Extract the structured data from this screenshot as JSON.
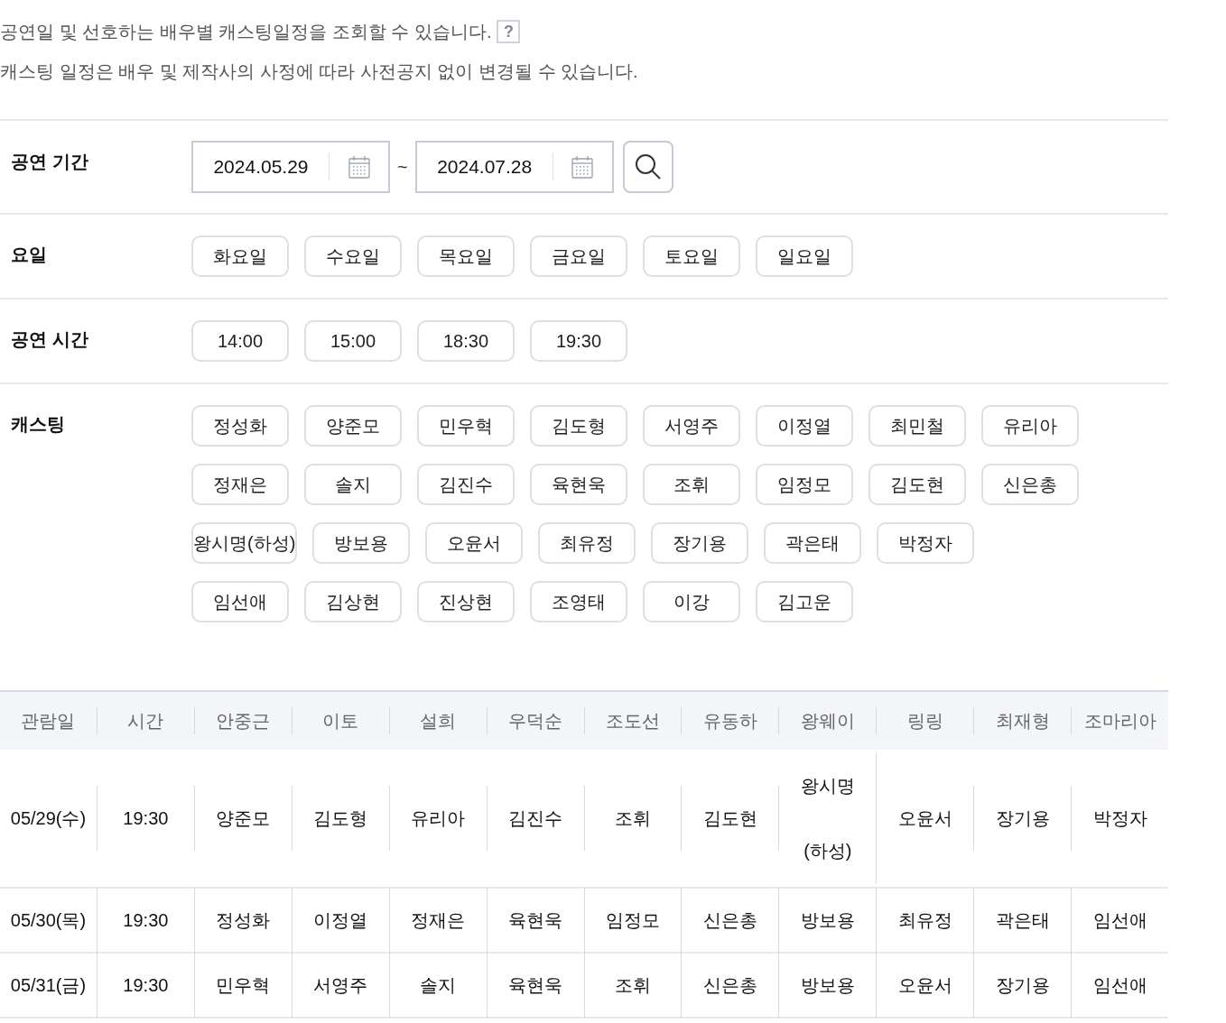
{
  "notes": [
    "공연일 및 선호하는 배우별 캐스팅일정을 조회할 수 있습니다.",
    "캐스팅 일정은 배우 및 제작사의 사정에 따라 사전공지 없이 변경될 수 있습니다."
  ],
  "help_button": "?",
  "period": {
    "label": "공연 기간",
    "start": "2024.05.29",
    "separator": "~",
    "end": "2024.07.28"
  },
  "days": {
    "label": "요일",
    "options": [
      {
        "label": "화요일",
        "selected": false
      },
      {
        "label": "수요일",
        "selected": false
      },
      {
        "label": "목요일",
        "selected": false
      },
      {
        "label": "금요일",
        "selected": false
      },
      {
        "label": "토요일",
        "selected": false
      },
      {
        "label": "일요일",
        "selected": false
      }
    ]
  },
  "times": {
    "label": "공연 시간",
    "options": [
      {
        "label": "14:00",
        "selected": false
      },
      {
        "label": "15:00",
        "selected": false
      },
      {
        "label": "18:30",
        "selected": false
      },
      {
        "label": "19:30",
        "selected": false
      }
    ]
  },
  "casting": {
    "label": "캐스팅",
    "rows": [
      [
        {
          "label": "정성화",
          "selected": false
        },
        {
          "label": "양준모",
          "selected": false
        },
        {
          "label": "민우혁",
          "selected": false
        },
        {
          "label": "김도형",
          "selected": false
        },
        {
          "label": "서영주",
          "selected": false
        },
        {
          "label": "이정열",
          "selected": false
        },
        {
          "label": "최민철",
          "selected": false
        },
        {
          "label": "유리아",
          "selected": false
        }
      ],
      [
        {
          "label": "정재은",
          "selected": false
        },
        {
          "label": "솔지",
          "selected": false
        },
        {
          "label": "김진수",
          "selected": false
        },
        {
          "label": "육현욱",
          "selected": false
        },
        {
          "label": "조휘",
          "selected": false
        },
        {
          "label": "임정모",
          "selected": false
        },
        {
          "label": "김도현",
          "selected": false
        },
        {
          "label": "신은총",
          "selected": false
        }
      ],
      [
        {
          "label": "왕시명(하성)",
          "selected": false
        },
        {
          "label": "방보용",
          "selected": false
        },
        {
          "label": "오윤서",
          "selected": false
        },
        {
          "label": "최유정",
          "selected": false
        },
        {
          "label": "장기용",
          "selected": false
        },
        {
          "label": "곽은태",
          "selected": false
        },
        {
          "label": "박정자",
          "selected": false
        }
      ],
      [
        {
          "label": "임선애",
          "selected": false
        },
        {
          "label": "김상현",
          "selected": false
        },
        {
          "label": "진상현",
          "selected": false
        },
        {
          "label": "조영태",
          "selected": false
        },
        {
          "label": "이강",
          "selected": false
        },
        {
          "label": "김고운",
          "selected": false
        }
      ]
    ]
  },
  "table": {
    "columns": [
      "관람일",
      "시간",
      "안중근",
      "이토",
      "설희",
      "우덕순",
      "조도선",
      "유동하",
      "왕웨이",
      "링링",
      "최재형",
      "조마리아"
    ],
    "rows": [
      [
        "05/29(수)",
        "19:30",
        "양준모",
        "김도형",
        "유리아",
        "김진수",
        "조휘",
        "김도현",
        "왕시명(하성)",
        "오윤서",
        "장기용",
        "박정자"
      ],
      [
        "05/30(목)",
        "19:30",
        "정성화",
        "이정열",
        "정재은",
        "육현욱",
        "임정모",
        "신은총",
        "방보용",
        "최유정",
        "곽은태",
        "임선애"
      ],
      [
        "05/31(금)",
        "19:30",
        "민우혁",
        "서영주",
        "솔지",
        "육현욱",
        "조휘",
        "신은총",
        "방보용",
        "오윤서",
        "장기용",
        "임선애"
      ]
    ]
  }
}
